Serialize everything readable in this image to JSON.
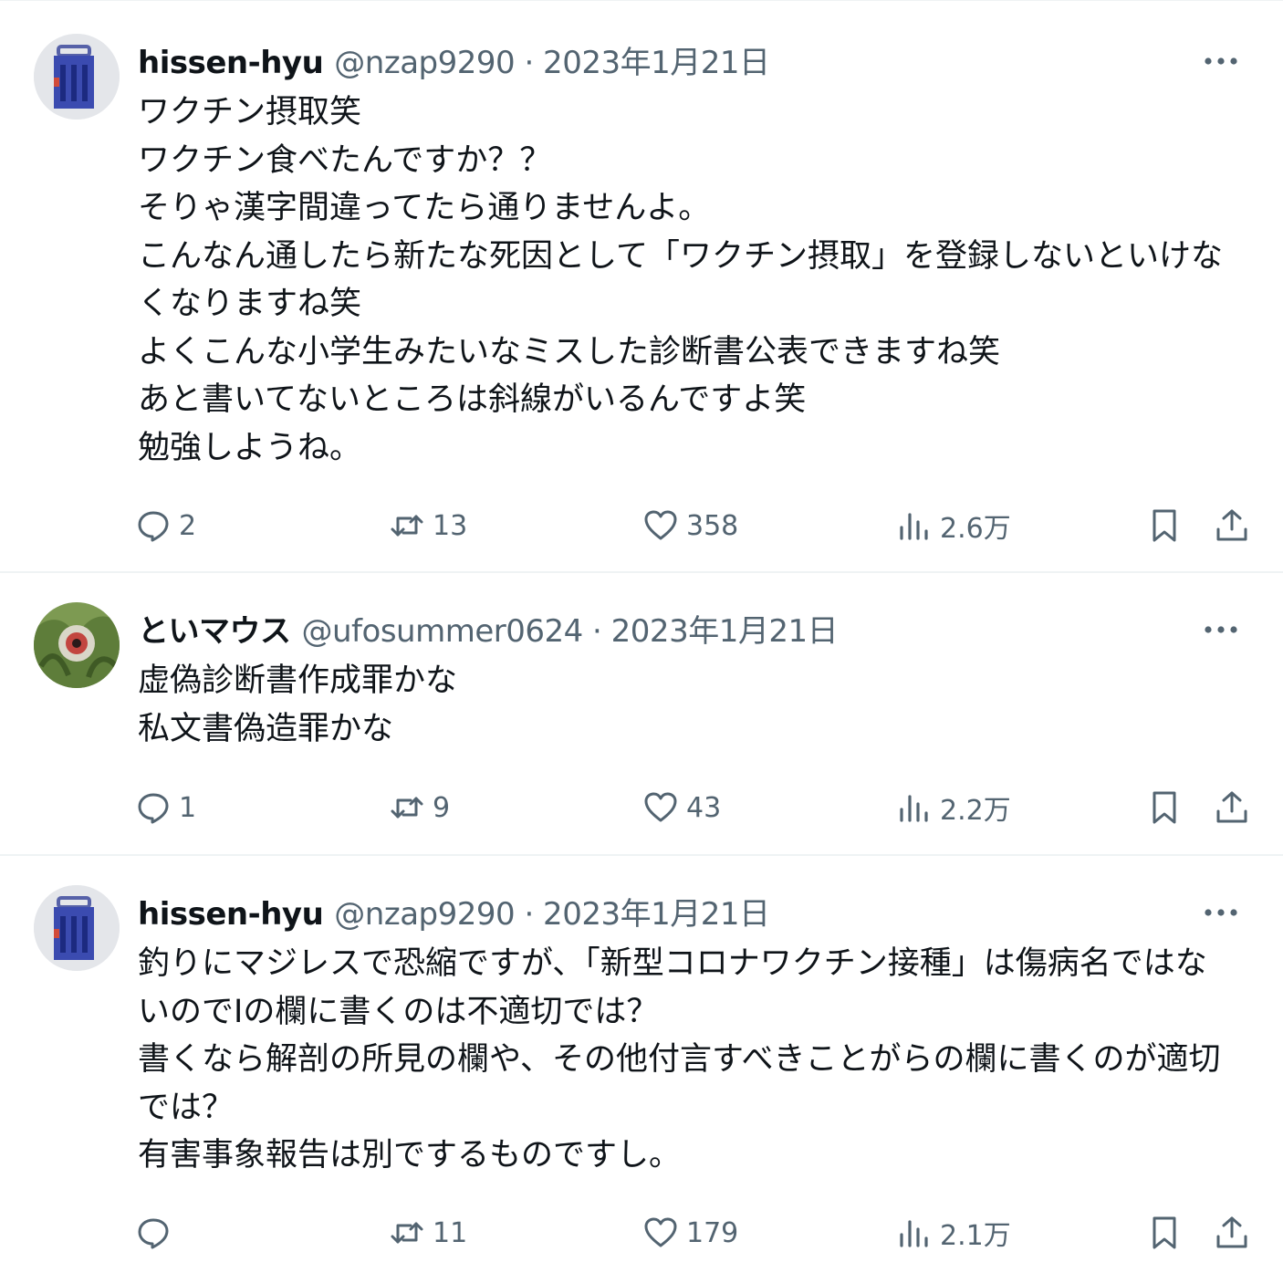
{
  "tweets": [
    {
      "name": "hissen-hyu",
      "meta": "@nzap9290 · 2023年1月21日",
      "text": "ワクチン摂取笑\nワクチン食べたんですか？？\nそりゃ漢字間違ってたら通りませんよ。\nこんなん通したら新たな死因として「ワクチン摂取」を登録しないといけな\nくなりますね笑\nよくこんな小学生みたいなミスした診断書公表できますね笑\nあと書いてないところは斜線がいるんですよ笑\n勉強しようね。",
      "replies": "2",
      "retweets": "13",
      "likes": "358",
      "views": "2.6万"
    },
    {
      "name": "といマウス",
      "meta": "@ufosummer0624 · 2023年1月21日",
      "text": "虚偽診断書作成罪かな\n私文書偽造罪かな",
      "replies": "1",
      "retweets": "9",
      "likes": "43",
      "views": "2.2万"
    },
    {
      "name": "hissen-hyu",
      "meta": "@nzap9290 · 2023年1月21日",
      "text": "釣りにマジレスで恐縮ですが、「新型コロナワクチン接種」は傷病名ではな\nいのでⅠの欄に書くのは不適切では？\n書くなら解剖の所見の欄や、その他付言すべきことがらの欄に書くのが適切\nでは？\n有害事象報告は別でするものですし。",
      "replies": "",
      "retweets": "11",
      "likes": "179",
      "views": "2.1万"
    }
  ],
  "icons": {
    "more": "more-horizontal-icon",
    "reply": "reply-bubble-icon",
    "retweet": "retweet-arrows-icon",
    "like": "heart-icon",
    "views": "bar-chart-icon",
    "bookmark": "bookmark-icon",
    "share": "share-upload-icon"
  },
  "colors": {
    "text": "#0f1419",
    "muted": "#536471",
    "divider": "#eff3f4"
  }
}
